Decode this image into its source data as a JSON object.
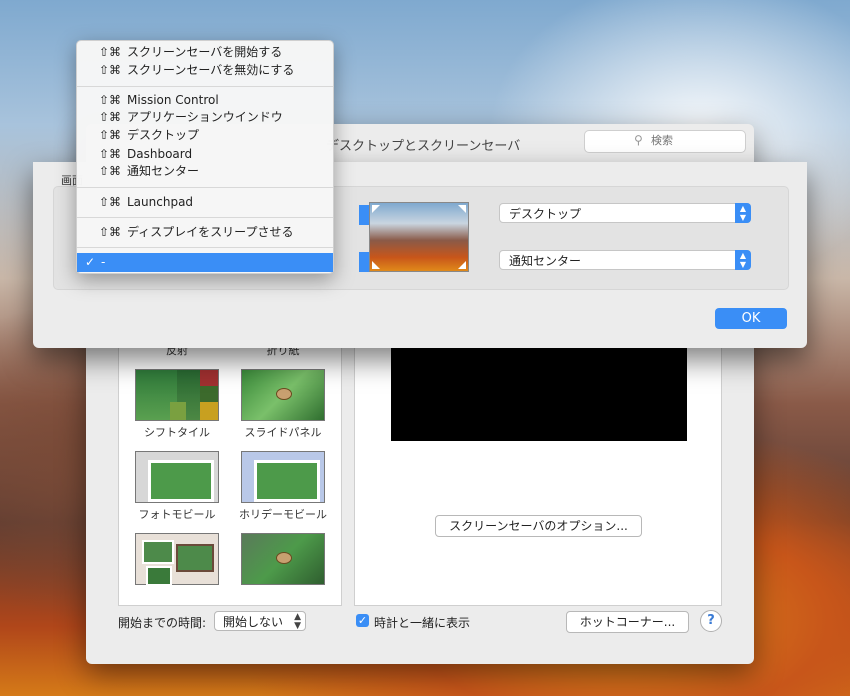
{
  "prefs": {
    "title": "デスクトップとスクリーンセーバ",
    "search_placeholder": "検索",
    "savers": [
      {
        "label": "反射"
      },
      {
        "label": "折り紙"
      },
      {
        "label": "シフトタイル"
      },
      {
        "label": "スライドパネル"
      },
      {
        "label": "フォトモビール"
      },
      {
        "label": "ホリデーモビール"
      },
      {
        "label": ""
      },
      {
        "label": ""
      }
    ],
    "options_button": "スクリーンセーバのオプション...",
    "start_label": "開始までの時間:",
    "start_value": "開始しない",
    "clock_label": "時計と一緒に表示",
    "clock_checked": true,
    "hot_corners_button": "ホットコーナー...",
    "help_label": "?"
  },
  "sheet": {
    "label": "画面",
    "top_right": "デスクトップ",
    "bottom_right": "通知センター",
    "ok_label": "OK"
  },
  "menu": {
    "items": [
      {
        "keys": "⇧⌘",
        "label": "スクリーンセーバを開始する"
      },
      {
        "keys": "⇧⌘",
        "label": "スクリーンセーバを無効にする"
      },
      {
        "keys": "⇧⌘",
        "label": "Mission Control"
      },
      {
        "keys": "⇧⌘",
        "label": "アプリケーションウインドウ"
      },
      {
        "keys": "⇧⌘",
        "label": "デスクトップ"
      },
      {
        "keys": "⇧⌘",
        "label": "Dashboard"
      },
      {
        "keys": "⇧⌘",
        "label": "通知センター"
      },
      {
        "keys": "⇧⌘",
        "label": "Launchpad"
      },
      {
        "keys": "⇧⌘",
        "label": "ディスプレイをスリープさせる"
      },
      {
        "keys": "✓",
        "label": "-"
      }
    ]
  },
  "colors": {
    "accent": "#3a8ef6"
  }
}
